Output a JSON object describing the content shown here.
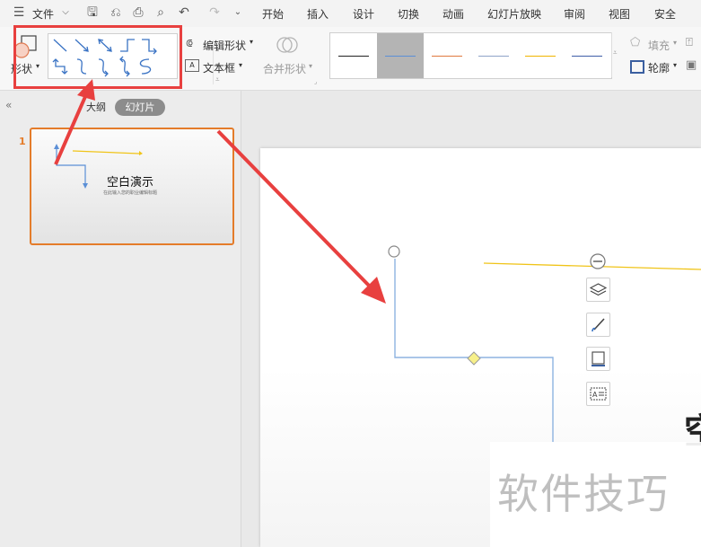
{
  "menubar": {
    "file_label": "文件",
    "tabs": [
      "开始",
      "插入",
      "设计",
      "切换",
      "动画",
      "幻灯片放映",
      "审阅",
      "视图",
      "安全"
    ]
  },
  "ribbon": {
    "shapes_label": "形状",
    "edit_shape_label": "编辑形状",
    "textbox_label": "文本框",
    "merge_shapes_label": "合并形状",
    "fill_label": "填充",
    "outline_label": "轮廓",
    "line_style_colors": [
      "#222222",
      "#5b8fd6",
      "#e0793f",
      "#8fa3c8",
      "#f0b400",
      "#3f5fa8"
    ]
  },
  "left_panel": {
    "tab_outline": "大纲",
    "tab_slides": "幻灯片",
    "slide_number": "1",
    "thumb_title": "空白演示",
    "thumb_subtitle": "在此输入您的职业编辑标题"
  },
  "canvas": {
    "title_fragment": "空"
  },
  "watermark": {
    "text": "软件技巧"
  },
  "colors": {
    "accent_orange": "#e47c2a",
    "annotation_red": "#e8403f",
    "connector_blue": "#8db3e0",
    "connector_yellow": "#f0c419"
  }
}
